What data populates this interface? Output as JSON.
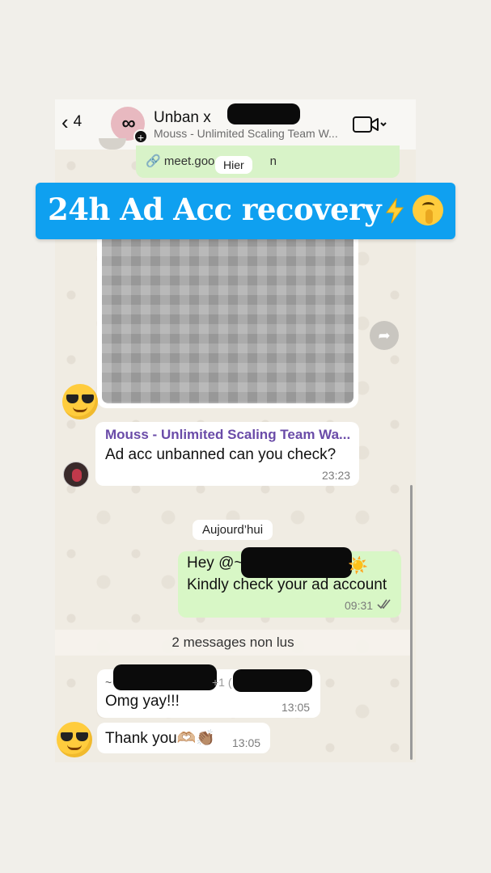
{
  "header": {
    "back_count": "4",
    "title": "Unban x",
    "subtitle": "Mouss - Unlimited Scaling Team W...",
    "colors": {
      "header_bg": "#f8f7f4",
      "avatar_bg": "#e8b9c0"
    }
  },
  "chat": {
    "link_preview": "meet.goo",
    "link_tail": "n",
    "date_pill": "Hier",
    "message_1": {
      "sender": "Mouss - Unlimited Scaling Team Wa...",
      "text": "Ad acc unbanned can you check?",
      "time": "23:23"
    },
    "day_pill": "Aujourd’hui",
    "message_2": {
      "line1_prefix": "Hey @~",
      "line2": "Kindly check your ad account",
      "time": "09:31"
    },
    "unread": "2 messages non lus",
    "message_3": {
      "sender_prefix": "~",
      "sender_mid": "+1 (",
      "text": "Omg yay!!!",
      "time": "13:05"
    },
    "message_4": {
      "text": "Thank you🫶🏼👏🏽",
      "time": "13:05"
    },
    "colors": {
      "outgoing": "#d8f7c6",
      "incoming": "#ffffff",
      "sender": "#6a4ba8"
    }
  },
  "banner": {
    "text": "24h Ad Acc recovery",
    "color": "#0fa0f0"
  }
}
